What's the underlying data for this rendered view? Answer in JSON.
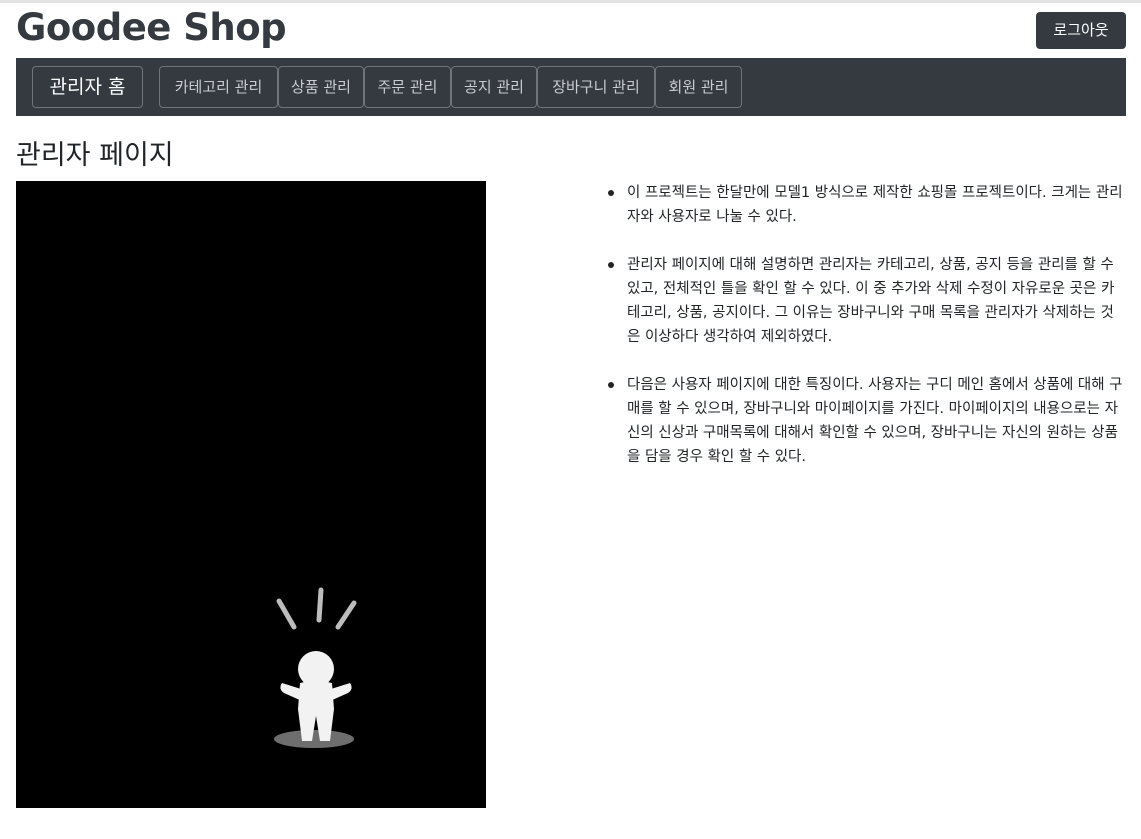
{
  "header": {
    "shop_title": "Goodee Shop",
    "logout_label": "로그아웃"
  },
  "nav": {
    "home_label": "관리자 홈",
    "items": [
      {
        "label": "카테고리 관리"
      },
      {
        "label": "상품 관리"
      },
      {
        "label": "주문 관리"
      },
      {
        "label": "공지 관리"
      },
      {
        "label": "장바구니 관리"
      },
      {
        "label": "회원 관리"
      }
    ]
  },
  "main": {
    "heading": "관리자 페이지",
    "descriptions": [
      "이 프로젝트는 한달만에 모델1 방식으로 제작한 쇼핑몰 프로젝트이다. 크게는 관리자와 사용자로 나눌 수 있다.",
      "관리자 페이지에 대해 설명하면 관리자는 카테고리, 상품, 공지 등을 관리를 할 수 있고, 전체적인 틀을 확인 할 수 있다. 이 중 추가와 삭제 수정이 자유로운 곳은 카테고리, 상품, 공지이다. 그 이유는 장바구니와 구매 목록을 관리자가 삭제하는 것은 이상하다 생각하여 제외하였다.",
      "다음은 사용자 페이지에 대한 특징이다. 사용자는 구디 메인 홈에서 상품에 대해 구매를 할 수 있으며, 장바구니와 마이페이지를 가진다. 마이페이지의 내용으로는 자신의 신상과 구매목록에 대해서 확인할 수 있으며, 장바구니는 자신의 원하는 상품을 담을 경우 확인 할 수 있다."
    ]
  },
  "colors": {
    "navbar_bg": "#343a40",
    "image_bg": "#000000"
  }
}
